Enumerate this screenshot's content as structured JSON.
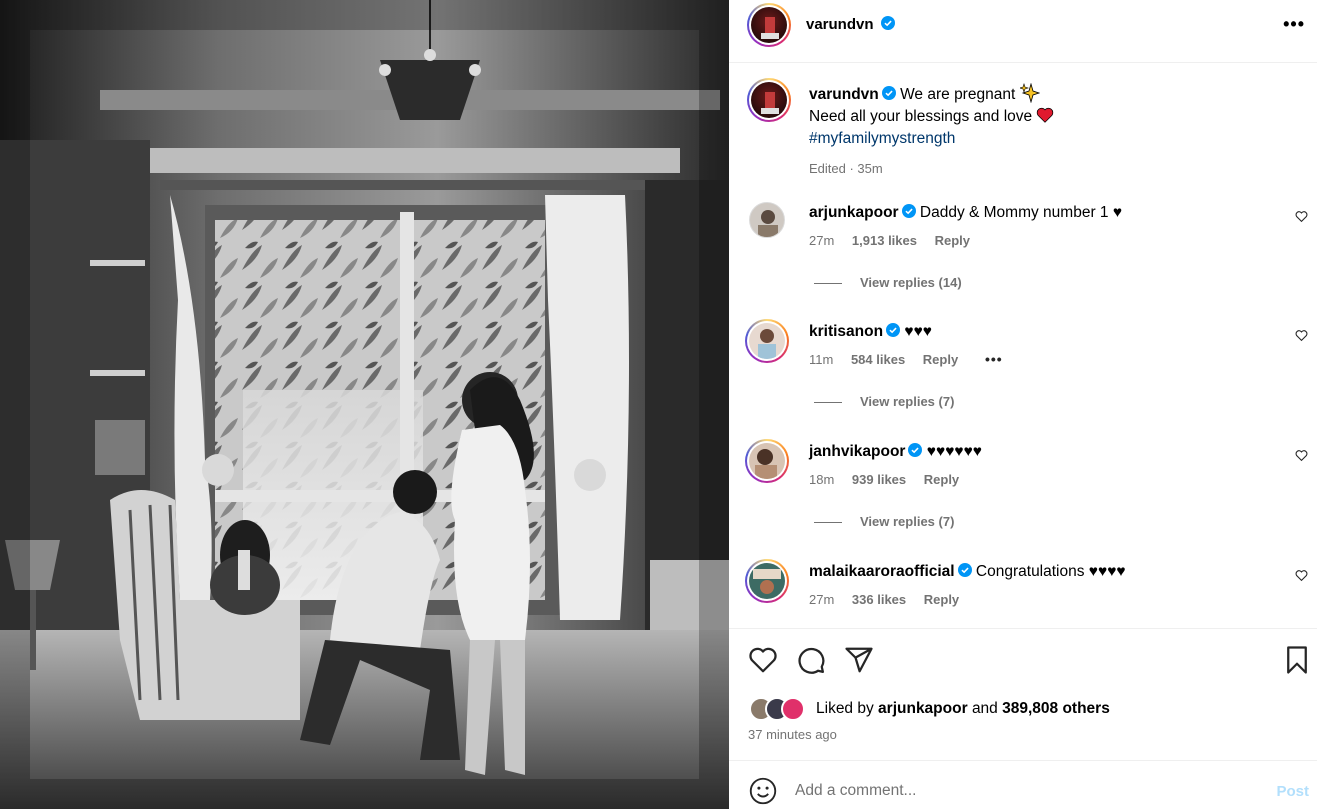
{
  "post_author": {
    "username": "varundvn",
    "verified": true
  },
  "caption": {
    "username": "varundvn",
    "line1": "We are pregnant",
    "line1_emoji": "sparkles-icon",
    "line2": "Need all your blessings and love",
    "line2_emoji": "red-heart-icon",
    "hashtag": "#myfamilymystrength",
    "meta": "Edited · 35m"
  },
  "comments": [
    {
      "username": "arjunkapoor",
      "verified": true,
      "text": "Daddy & Mommy number 1 ♥",
      "time": "27m",
      "likes": "1,913 likes",
      "reply": "Reply",
      "view_replies": "View replies (14)"
    },
    {
      "username": "kritisanon",
      "verified": true,
      "text": "♥♥♥",
      "time": "11m",
      "likes": "584 likes",
      "reply": "Reply",
      "more": "•••",
      "view_replies": "View replies (7)"
    },
    {
      "username": "janhvikapoor",
      "verified": true,
      "text": "♥♥♥♥♥♥",
      "time": "18m",
      "likes": "939 likes",
      "reply": "Reply",
      "view_replies": "View replies (7)"
    },
    {
      "username": "malaikaaroraofficial",
      "verified": true,
      "text": "Congratulations ♥♥♥♥",
      "time": "27m",
      "likes": "336 likes",
      "reply": "Reply"
    }
  ],
  "liked_by": {
    "prefix": "Liked by",
    "user": "arjunkapoor",
    "and": "and",
    "others": "389,808 others"
  },
  "time_ago": "37 minutes ago",
  "add_comment": {
    "placeholder": "Add a comment...",
    "post_label": "Post"
  },
  "header_more": "•••",
  "colors": {
    "verified": "#0095f6",
    "link": "#00376b",
    "muted": "#737373",
    "post_disabled": "#b2dffc"
  }
}
